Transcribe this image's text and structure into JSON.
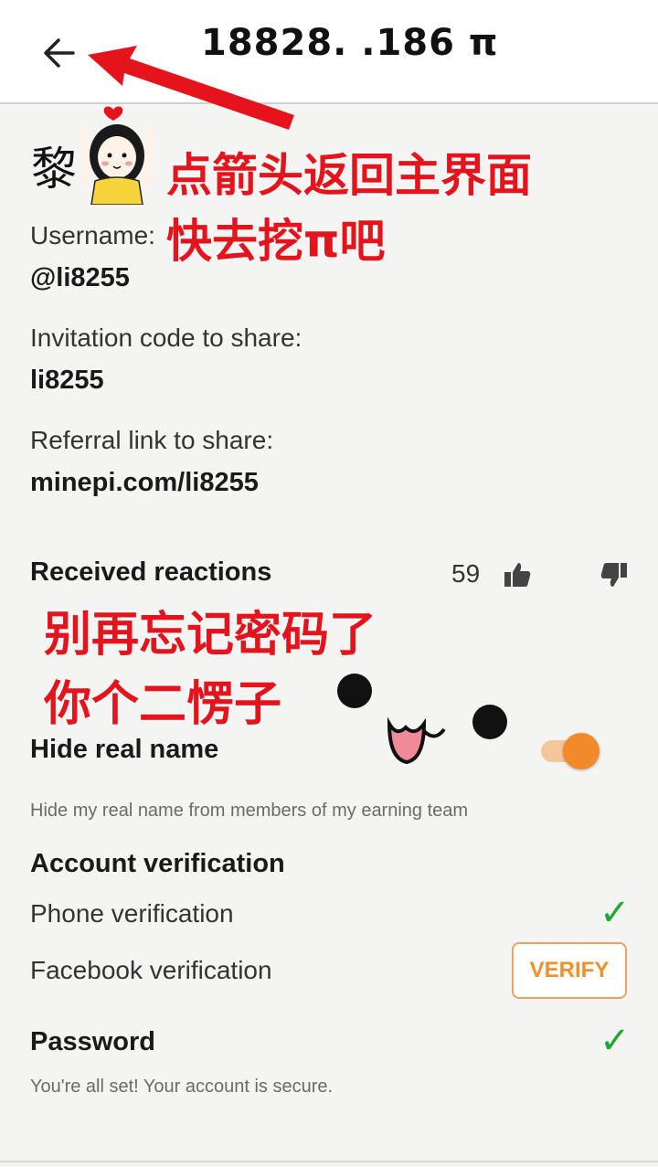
{
  "header": {
    "balance": "18828.  .186 π",
    "back_icon": "arrow-left-icon"
  },
  "annotations": {
    "note1": "点箭头返回主界面",
    "note2": "快去挖π吧",
    "note3": "别再忘记密码了",
    "note4": "你个二愣子"
  },
  "profile": {
    "avatar_char": "黎",
    "username_label": "Username:",
    "username_value": "@li8255",
    "invite_label": "Invitation code to share:",
    "invite_value": "li8255",
    "referral_label": "Referral link to share:",
    "referral_value": "minepi.com/li8255"
  },
  "reactions": {
    "heading": "Received reactions",
    "count": "59",
    "up_icon": "thumbs-up-icon",
    "down_icon": "thumbs-down-icon"
  },
  "privacy": {
    "heading": "Hide real name",
    "description": "Hide my real name from members of my earning team",
    "toggle_on": true
  },
  "verification": {
    "heading": "Account verification",
    "phone_label": "Phone verification",
    "phone_status": "✓",
    "facebook_label": "Facebook verification",
    "facebook_button": "VERIFY"
  },
  "password": {
    "heading": "Password",
    "status": "✓",
    "description": "You're all set! Your account is secure."
  },
  "colors": {
    "accent_orange": "#f28a2c",
    "check_green": "#22a63a",
    "annotation_red": "#e5141c"
  }
}
